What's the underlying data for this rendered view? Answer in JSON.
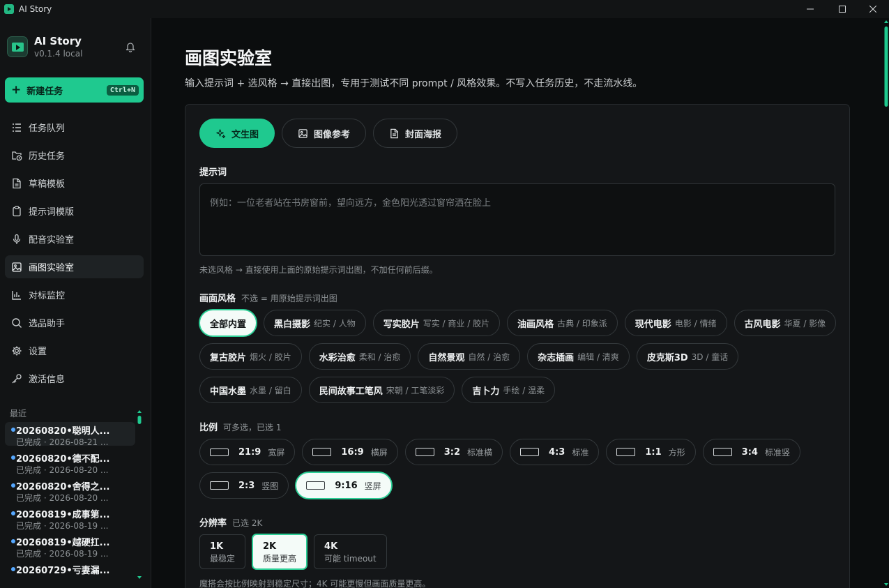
{
  "window": {
    "title": "AI Story"
  },
  "sidebar": {
    "app_name": "AI Story",
    "version": "v0.1.4 local",
    "new_task": {
      "label": "新建任务",
      "shortcut": "Ctrl+N"
    },
    "items": [
      {
        "label": "任务队列",
        "icon": "list-icon"
      },
      {
        "label": "历史任务",
        "icon": "folder-clock-icon"
      },
      {
        "label": "草稿模板",
        "icon": "file-icon"
      },
      {
        "label": "提示词模版",
        "icon": "clipboard-icon"
      },
      {
        "label": "配音实验室",
        "icon": "mic-icon"
      },
      {
        "label": "画图实验室",
        "icon": "image-icon",
        "active": true
      },
      {
        "label": "对标监控",
        "icon": "bar-chart-icon"
      },
      {
        "label": "选品助手",
        "icon": "search-icon"
      },
      {
        "label": "设置",
        "icon": "gear-icon"
      },
      {
        "label": "激活信息",
        "icon": "key-icon"
      }
    ],
    "recent_label": "最近",
    "recent": [
      {
        "title": "20260820•聪明人...",
        "status": "已完成 · 2026-08-21 ..."
      },
      {
        "title": "20260820•德不配...",
        "status": "已完成 · 2026-08-20 ..."
      },
      {
        "title": "20260820•舍得之...",
        "status": "已完成 · 2026-08-20 ..."
      },
      {
        "title": "20260819•成事第...",
        "status": "已完成 · 2026-08-19 ..."
      },
      {
        "title": "20260819•越硬扛...",
        "status": "已完成 · 2026-08-19 ..."
      },
      {
        "title": "20260729•亏妻漏...",
        "status": ""
      }
    ]
  },
  "main": {
    "title": "画图实验室",
    "subtitle": "输入提示词 + 选风格 → 直接出图，专用于测试不同 prompt / 风格效果。不写入任务历史，不走流水线。",
    "tabs": [
      {
        "label": "文生图",
        "icon": "sparkle-icon"
      },
      {
        "label": "图像参考",
        "icon": "image-icon"
      },
      {
        "label": "封面海报",
        "icon": "file-text-icon"
      }
    ],
    "prompt_label": "提示词",
    "prompt_placeholder": "例如：一位老者站在书房窗前，望向远方，金色阳光透过窗帘洒在脸上",
    "prompt_note": "未选风格 → 直接使用上面的原始提示词出图，不加任何前后缀。",
    "style_label": "画面风格",
    "style_hint": "不选 = 用原始提示词出图",
    "styles": [
      {
        "name": "全部内置",
        "desc": ""
      },
      {
        "name": "黑白摄影",
        "desc": "纪实 / 人物"
      },
      {
        "name": "写实胶片",
        "desc": "写实 / 商业 / 胶片"
      },
      {
        "name": "油画风格",
        "desc": "古典 / 印象派"
      },
      {
        "name": "现代电影",
        "desc": "电影 / 情绪"
      },
      {
        "name": "古风电影",
        "desc": "华夏 / 影像"
      },
      {
        "name": "复古胶片",
        "desc": "烟火 / 胶片"
      },
      {
        "name": "水彩治愈",
        "desc": "柔和 / 治愈"
      },
      {
        "name": "自然景观",
        "desc": "自然 / 治愈"
      },
      {
        "name": "杂志插画",
        "desc": "编辑 / 清爽"
      },
      {
        "name": "皮克斯3D",
        "desc": "3D / 童话"
      },
      {
        "name": "中国水墨",
        "desc": "水墨 / 留白"
      },
      {
        "name": "民间故事工笔风",
        "desc": "宋朝 / 工笔淡彩"
      },
      {
        "name": "吉卜力",
        "desc": "手绘 / 温柔"
      }
    ],
    "ratio_label": "比例",
    "ratio_hint": "可多选，已选 1",
    "ratios": [
      {
        "value": "21:9",
        "desc": "宽屏"
      },
      {
        "value": "16:9",
        "desc": "横屏"
      },
      {
        "value": "3:2",
        "desc": "标准横"
      },
      {
        "value": "4:3",
        "desc": "标准"
      },
      {
        "value": "1:1",
        "desc": "方形"
      },
      {
        "value": "3:4",
        "desc": "标准竖"
      },
      {
        "value": "2:3",
        "desc": "竖图"
      },
      {
        "value": "9:16",
        "desc": "竖屏"
      }
    ],
    "resolution_label": "分辨率",
    "resolution_hint": "已选 2K",
    "resolutions": [
      {
        "value": "1K",
        "desc": "最稳定"
      },
      {
        "value": "2K",
        "desc": "质量更高"
      },
      {
        "value": "4K",
        "desc": "可能 timeout"
      }
    ],
    "resolution_note": "魔搭会按比例映射到稳定尺寸；4K 可能更慢但画面质量更高。"
  }
}
